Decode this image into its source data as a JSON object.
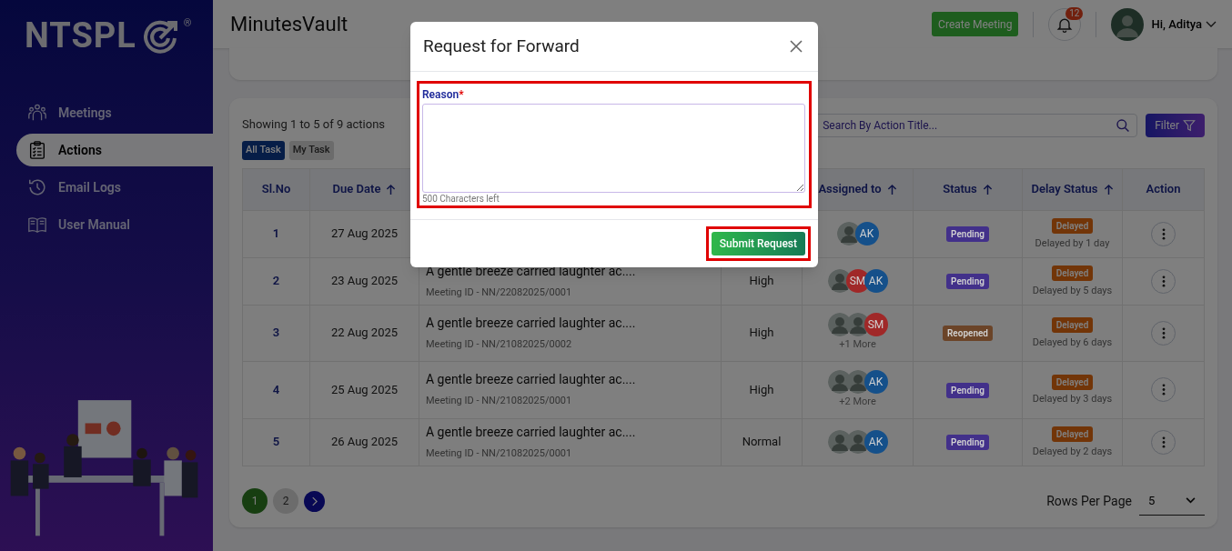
{
  "sidebar": {
    "logo": {
      "text": "NTSPL",
      "mark": "®"
    },
    "items": [
      {
        "label": "Meetings",
        "selected": false
      },
      {
        "label": "Actions",
        "selected": true
      },
      {
        "label": "Email Logs",
        "selected": false
      },
      {
        "label": "User Manual",
        "selected": false
      }
    ]
  },
  "header": {
    "title": "MinutesVault",
    "create_button": "Create Meeting",
    "notification_count": "12",
    "greeting": "Hi, Aditya"
  },
  "toolbar": {
    "summary": "Showing 1 to 5 of 9 actions",
    "task_tabs": [
      {
        "label": "All Task",
        "selected": true
      },
      {
        "label": "My Task",
        "selected": false
      }
    ],
    "search": {
      "placeholder": "Search By Action Title..."
    },
    "filter_button": "Filter"
  },
  "table": {
    "columns": [
      {
        "label": "Sl.No",
        "sortable": false
      },
      {
        "label": "Due Date",
        "sortable": true
      },
      {
        "label": "Assigned to",
        "sortable": true
      },
      {
        "label": "Status",
        "sortable": true
      },
      {
        "label": "Delay Status",
        "sortable": true
      },
      {
        "label": "Action",
        "sortable": false
      }
    ],
    "rows": [
      {
        "sl": "1",
        "due_date": "27 Aug 2025",
        "assignees": [
          {
            "kind": "photo"
          },
          {
            "kind": "initials",
            "initials": "AK",
            "color": "#15508a"
          }
        ],
        "status": {
          "label": "Pending",
          "color": "#42308a"
        },
        "delay": {
          "label": "Delayed",
          "detail": "Delayed by 1 day"
        }
      },
      {
        "sl": "2",
        "due_date": "23 Aug 2025",
        "title": "A gentle breeze carried laughter ac....",
        "meeting_id": "Meeting ID - NN/22082025/0001",
        "priority": "High",
        "assignees": [
          {
            "kind": "photo"
          },
          {
            "kind": "initials",
            "initials": "SM",
            "color": "#a02828"
          },
          {
            "kind": "initials",
            "initials": "AK",
            "color": "#15508a"
          }
        ],
        "status": {
          "label": "Pending",
          "color": "#42308a"
        },
        "delay": {
          "label": "Delayed",
          "detail": "Delayed by 5 days"
        }
      },
      {
        "sl": "3",
        "due_date": "22 Aug 2025",
        "title": "A gentle breeze carried laughter ac....",
        "meeting_id": "Meeting ID - NN/21082025/0002",
        "priority": "High",
        "assignees": [
          {
            "kind": "photo"
          },
          {
            "kind": "photo"
          },
          {
            "kind": "initials",
            "initials": "SM",
            "color": "#a02828"
          }
        ],
        "more": "+1 More",
        "status": {
          "label": "Reopened",
          "color": "#6b4428"
        },
        "delay": {
          "label": "Delayed",
          "detail": "Delayed by 6 days"
        }
      },
      {
        "sl": "4",
        "due_date": "25 Aug 2025",
        "title": "A gentle breeze carried laughter ac....",
        "meeting_id": "Meeting ID - NN/21082025/0001",
        "priority": "High",
        "assignees": [
          {
            "kind": "photo"
          },
          {
            "kind": "photo"
          },
          {
            "kind": "initials",
            "initials": "AK",
            "color": "#15508a"
          }
        ],
        "more": "+2 More",
        "status": {
          "label": "Pending",
          "color": "#42308a"
        },
        "delay": {
          "label": "Delayed",
          "detail": "Delayed by 3 days"
        }
      },
      {
        "sl": "5",
        "due_date": "26 Aug 2025",
        "title": "A gentle breeze carried laughter ac....",
        "meeting_id": "Meeting ID - NN/21082025/0001",
        "priority": "Normal",
        "assignees": [
          {
            "kind": "photo"
          },
          {
            "kind": "photo"
          },
          {
            "kind": "initials",
            "initials": "AK",
            "color": "#15508a"
          }
        ],
        "status": {
          "label": "Pending",
          "color": "#42308a"
        },
        "delay": {
          "label": "Delayed",
          "detail": "Delayed by 2 days"
        }
      }
    ]
  },
  "pagination": {
    "pages": [
      {
        "label": "1",
        "selected": true
      },
      {
        "label": "2",
        "selected": false
      }
    ],
    "rows_per_page_label": "Rows Per Page",
    "rows_per_page": "5"
  },
  "modal": {
    "title": "Request for Forward",
    "field": {
      "label": "Reason",
      "required_mark": "*",
      "counter": "500 Characters left",
      "highlighted": true
    },
    "submit": {
      "label": "Submit Request",
      "highlighted": true
    }
  }
}
